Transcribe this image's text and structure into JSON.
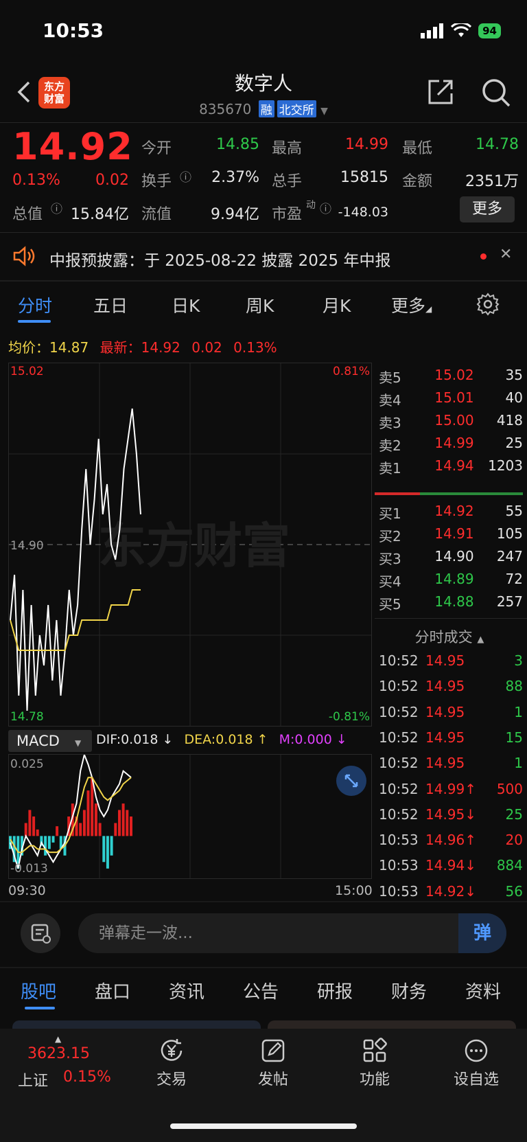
{
  "status": {
    "time": "10:53",
    "battery": "94"
  },
  "header": {
    "logo_line1": "东方",
    "logo_line2": "财富",
    "title": "数字人",
    "code": "835670",
    "tag1": "融",
    "tag2": "北交所"
  },
  "quote": {
    "price": "14.92",
    "pct": "0.13%",
    "chg": "0.02",
    "open_label": "今开",
    "open": "14.85",
    "high_label": "最高",
    "high": "14.99",
    "low_label": "最低",
    "low": "14.78",
    "turnover_label": "换手",
    "turnover": "2.37%",
    "volume_label": "总手",
    "volume": "15815",
    "amount_label": "金额",
    "amount": "2351万",
    "mcap_label": "总值",
    "mcap": "15.84亿",
    "float_label": "流值",
    "float_cap": "9.94亿",
    "pe_label": "市盈",
    "pe_sup": "动",
    "pe": "-148.03",
    "more": "更多"
  },
  "notice": {
    "text": "中报预披露：于 2025-08-22 披露 2025 年中报"
  },
  "tabs": [
    "分时",
    "五日",
    "日K",
    "周K",
    "月K",
    "更多"
  ],
  "avg": {
    "avg_label": "均价：",
    "avg": "14.87",
    "latest_label": "最新：",
    "latest": "14.92",
    "chg": "0.02",
    "pct": "0.13%"
  },
  "chart_axes": {
    "ymax": "15.02",
    "ymid": "14.90",
    "ymin": "14.78",
    "pmax": "0.81%",
    "pmin": "-0.81%",
    "watermark": "东方财富",
    "t_start": "09:30",
    "t_end": "15:00"
  },
  "chart_data": {
    "type": "line",
    "ylim": [
      14.78,
      15.02
    ],
    "series": [
      {
        "values": [
          14.85,
          14.88,
          14.8,
          14.87,
          14.79,
          14.86,
          14.8,
          14.84,
          14.82,
          14.86,
          14.81,
          14.85,
          14.8,
          14.83,
          14.87,
          14.84,
          14.86,
          14.91,
          14.95,
          14.9,
          14.93,
          14.97,
          14.92,
          14.94,
          14.9,
          14.89,
          14.91,
          14.95,
          14.97,
          14.99,
          14.96,
          14.92
        ]
      },
      {
        "values": [
          14.85,
          14.84,
          14.83,
          14.83,
          14.83,
          14.83,
          14.83,
          14.83,
          14.83,
          14.83,
          14.83,
          14.83,
          14.83,
          14.83,
          14.84,
          14.84,
          14.84,
          14.85,
          14.85,
          14.85,
          14.85,
          14.85,
          14.85,
          14.85,
          14.86,
          14.86,
          14.86,
          14.86,
          14.86,
          14.87,
          14.87,
          14.87
        ]
      }
    ]
  },
  "macd": {
    "label": "MACD",
    "dif": "DIF:0.018",
    "dea": "DEA:0.018",
    "m": "M:0.000",
    "ymax": "0.025",
    "ymin": "-0.013"
  },
  "macd_data": {
    "bars": [
      -0.004,
      -0.008,
      -0.01,
      -0.006,
      0.004,
      0.008,
      0.006,
      0.002,
      -0.003,
      -0.006,
      -0.004,
      -0.002,
      0.003,
      -0.004,
      -0.006,
      0.006,
      0.01,
      0.006,
      0.004,
      0.008,
      0.014,
      0.018,
      0.01,
      0.004,
      -0.008,
      -0.01,
      -0.006,
      0.004,
      0.008,
      0.01,
      0.008,
      0.006
    ],
    "dif": [
      -0.002,
      -0.006,
      -0.01,
      -0.004,
      0.0,
      -0.002,
      -0.004,
      -0.006,
      -0.002,
      -0.004,
      -0.006,
      -0.008,
      -0.006,
      -0.004,
      -0.002,
      0.002,
      0.006,
      0.01,
      0.02,
      0.025,
      0.022,
      0.018,
      0.012,
      0.008,
      0.006,
      0.008,
      0.012,
      0.014,
      0.016,
      0.02,
      0.019,
      0.018
    ],
    "dea": [
      -0.001,
      -0.003,
      -0.005,
      -0.005,
      -0.004,
      -0.003,
      -0.003,
      -0.004,
      -0.004,
      -0.004,
      -0.005,
      -0.005,
      -0.005,
      -0.004,
      -0.003,
      -0.001,
      0.002,
      0.005,
      0.01,
      0.015,
      0.018,
      0.018,
      0.016,
      0.014,
      0.012,
      0.011,
      0.012,
      0.013,
      0.014,
      0.016,
      0.017,
      0.018
    ]
  },
  "orderbook": {
    "asks": [
      {
        "label": "卖5",
        "price": "15.02",
        "vol": "35",
        "color": "red"
      },
      {
        "label": "卖4",
        "price": "15.01",
        "vol": "40",
        "color": "red"
      },
      {
        "label": "卖3",
        "price": "15.00",
        "vol": "418",
        "color": "red"
      },
      {
        "label": "卖2",
        "price": "14.99",
        "vol": "25",
        "color": "red"
      },
      {
        "label": "卖1",
        "price": "14.94",
        "vol": "1203",
        "color": "red"
      }
    ],
    "bids": [
      {
        "label": "买1",
        "price": "14.92",
        "vol": "55",
        "color": "red"
      },
      {
        "label": "买2",
        "price": "14.91",
        "vol": "105",
        "color": "red"
      },
      {
        "label": "买3",
        "price": "14.90",
        "vol": "247",
        "color": "white"
      },
      {
        "label": "买4",
        "price": "14.89",
        "vol": "72",
        "color": "green"
      },
      {
        "label": "买5",
        "price": "14.88",
        "vol": "257",
        "color": "green"
      }
    ]
  },
  "trades_header": "分时成交",
  "trades": [
    {
      "time": "10:52",
      "price": "14.95",
      "vol": "3",
      "vcolor": "green"
    },
    {
      "time": "10:52",
      "price": "14.95",
      "vol": "88",
      "vcolor": "green"
    },
    {
      "time": "10:52",
      "price": "14.95",
      "vol": "1",
      "vcolor": "green"
    },
    {
      "time": "10:52",
      "price": "14.95",
      "vol": "15",
      "vcolor": "green"
    },
    {
      "time": "10:52",
      "price": "14.95",
      "vol": "1",
      "vcolor": "green"
    },
    {
      "time": "10:52",
      "price": "14.99↑",
      "vol": "500",
      "vcolor": "red"
    },
    {
      "time": "10:52",
      "price": "14.95↓",
      "vol": "25",
      "vcolor": "green"
    },
    {
      "time": "10:53",
      "price": "14.96↑",
      "vol": "20",
      "vcolor": "red"
    },
    {
      "time": "10:53",
      "price": "14.94↓",
      "vol": "884",
      "vcolor": "green"
    },
    {
      "time": "10:53",
      "price": "14.92↓",
      "vol": "56",
      "vcolor": "green"
    }
  ],
  "comment": {
    "placeholder": "弹幕走一波...",
    "danmu": "弹"
  },
  "bottom_tabs": [
    "股吧",
    "盘口",
    "资讯",
    "公告",
    "研报",
    "财务",
    "资料"
  ],
  "nav": {
    "index_val": "3623.15",
    "index_name": "上证",
    "index_pct": "0.15%",
    "trade": "交易",
    "post": "发帖",
    "func": "功能",
    "watch": "设自选"
  }
}
